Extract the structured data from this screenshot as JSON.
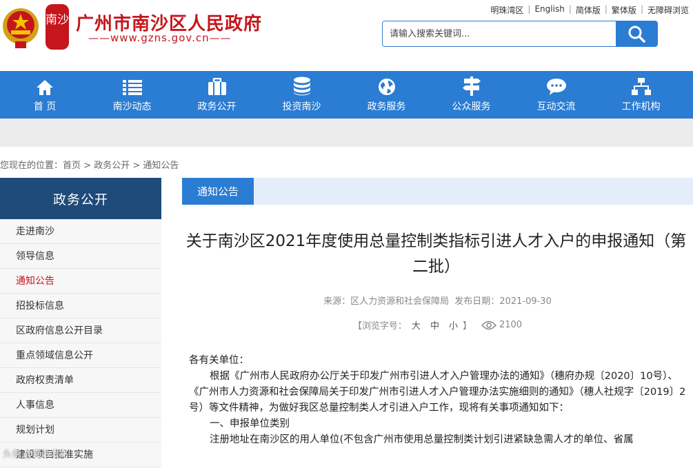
{
  "header": {
    "site_title": "广州市南沙区人民政府",
    "site_url": "——www.gzns.gov.cn——",
    "seal_text": "南沙",
    "top_links": [
      "明珠湾区",
      "English",
      "简体版",
      "繁体版",
      "无障碍浏览"
    ],
    "search_placeholder": "请输入搜索关键词..."
  },
  "nav": {
    "items": [
      {
        "label": "首 页",
        "icon": "home-icon"
      },
      {
        "label": "南沙动态",
        "icon": "list-icon"
      },
      {
        "label": "政务公开",
        "icon": "briefcase-icon"
      },
      {
        "label": "投资南沙",
        "icon": "coins-icon"
      },
      {
        "label": "政务服务",
        "icon": "globe-icon"
      },
      {
        "label": "公众服务",
        "icon": "signpost-icon"
      },
      {
        "label": "互动交流",
        "icon": "chat-icon"
      },
      {
        "label": "工作机构",
        "icon": "org-chart-icon"
      }
    ]
  },
  "breadcrumb": {
    "prefix": "您现在的位置：",
    "items": [
      "首页",
      "政务公开",
      "通知公告"
    ],
    "separator": " > "
  },
  "sidebar": {
    "title": "政务公开",
    "items": [
      {
        "label": "走进南沙",
        "active": false
      },
      {
        "label": "领导信息",
        "active": false
      },
      {
        "label": "通知公告",
        "active": true
      },
      {
        "label": "招投标信息",
        "active": false
      },
      {
        "label": "区政府信息公开目录",
        "active": false
      },
      {
        "label": "重点领域信息公开",
        "active": false
      },
      {
        "label": "政府权责清单",
        "active": false
      },
      {
        "label": "人事信息",
        "active": false
      },
      {
        "label": "规划计划",
        "active": false
      },
      {
        "label": "建设项目批准实施",
        "active": false
      }
    ]
  },
  "article": {
    "tab": "通知公告",
    "title": "关于南沙区2021年度使用总量控制类指标引进人才入户的申报通知（第二批）",
    "source": "来源：区人力资源和社会保障局",
    "date": "发布日期：2021-09-30",
    "font_label_open": "【浏览字号：",
    "font_sizes": [
      "大",
      "中",
      "小"
    ],
    "font_label_close": "】",
    "views": "2100",
    "paragraphs": [
      {
        "text": "各有关单位：",
        "indent": false
      },
      {
        "text": "根据《广州市人民政府办公厅关于印发广州市引进人才入户管理办法的通知》（穗府办规〔2020〕10号）、《广州市人力资源和社会保障局关于印发广州市引进人才入户管理办法实施细则的通知》（穗人社规字〔2019〕2号）等文件精神，为做好我区总量控制类人才引进入户工作，现将有关事项通知如下：",
        "indent": true
      },
      {
        "text": "一、申报单位类别",
        "indent": true
      },
      {
        "text": "注册地址在南沙区的用人单位(不包含广州市使用总量控制类计划引进紧缺急需人才的单位、省属",
        "indent": true
      }
    ]
  },
  "watermark": "头条 @南沙发布",
  "colors": {
    "brand_red": "#c4161c",
    "nav_blue": "#2b7cd3",
    "sidebar_head": "#1e4b7a"
  }
}
